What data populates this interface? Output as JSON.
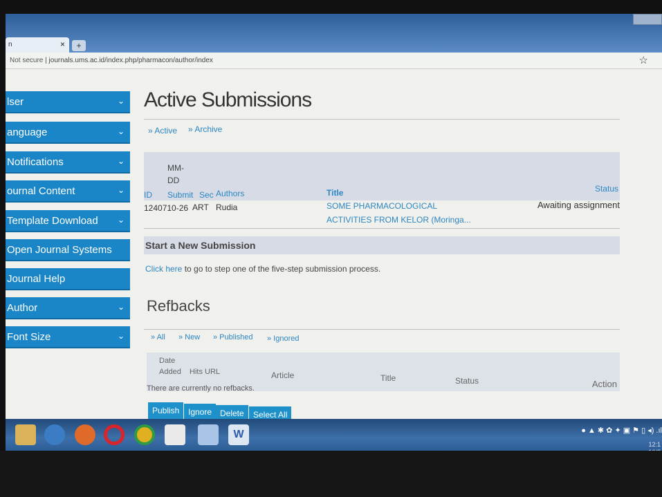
{
  "browser": {
    "tab_title": "n",
    "tab_close": "×",
    "new_tab": "+",
    "not_secure": "Not secure",
    "url": "journals.ums.ac.id/index.php/pharmacon/author/index",
    "star": "☆"
  },
  "sidebar": {
    "items": [
      {
        "label": "lser",
        "chevron": true
      },
      {
        "label": "anguage",
        "chevron": true
      },
      {
        "label": "Notifications",
        "chevron": true
      },
      {
        "label": "ournal Content",
        "chevron": true
      },
      {
        "label": "Template Download",
        "chevron": true
      },
      {
        "label": "Open Journal Systems",
        "chevron": false
      },
      {
        "label": "Journal Help",
        "chevron": false
      },
      {
        "label": "Author",
        "chevron": true
      },
      {
        "label": "Font Size",
        "chevron": true
      }
    ],
    "chevron_glyph": "⌄"
  },
  "main": {
    "title": "Active Submissions",
    "subnav": {
      "active": "» Active",
      "archive": "» Archive"
    },
    "table": {
      "col_mmdd_1": "MM-",
      "col_mmdd_2": "DD",
      "col_id": "ID",
      "col_submit": "Submit",
      "col_sec": "Sec",
      "col_authors": "Authors",
      "col_title": "Title",
      "col_status": "Status",
      "row": {
        "id_date": "1240710-26",
        "sec": "ART",
        "authors": "Rudia",
        "title_1": "SOME PHARMACOLOGICAL",
        "title_2": "ACTIVITIES FROM KELOR (Moringa...",
        "status": "Awaiting assignment"
      }
    },
    "new_submission": {
      "heading": "Start a New Submission",
      "link": "Click here",
      "text": " to go to step one of the five-step submission process."
    },
    "refbacks": {
      "title": "Refbacks",
      "filters": {
        "all": "» All",
        "new": "» New",
        "published": "» Published",
        "ignored": "» Ignored"
      },
      "cols": {
        "date": "Date",
        "added": "Added",
        "hits": "Hits",
        "url": "URL",
        "article": "Article",
        "title": "Title",
        "status": "Status",
        "action": "Action"
      },
      "empty": "There are currently no refbacks.",
      "buttons": {
        "publish": "Publish",
        "ignore": "Ignore",
        "delete": "Delete",
        "select_all": "Select All"
      }
    }
  },
  "taskbar": {
    "tray_icons": "● ▲ ✱ ✿ ✦ ▣ ⚑ ▯ ◂) .ıl",
    "time": "12:1",
    "date": "10/2",
    "word_label": "W"
  }
}
